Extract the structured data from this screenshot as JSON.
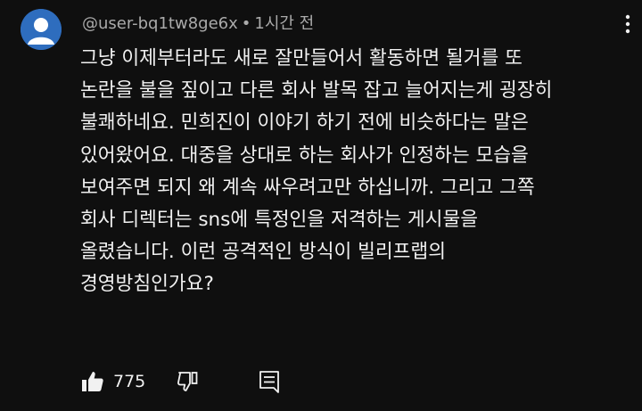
{
  "comment": {
    "author": "@user-bq1tw8ge6x",
    "separator": "•",
    "time": "1시간 전",
    "lines": [
      "그냥 이제부터라도 새로 잘만들어서 활동하면 될거를 또",
      "논란을 불을 짚이고 다른 회사 발목 잡고 늘어지는게 굉장히",
      "불쾌하네요. 민희진이 이야기 하기 전에 비슷하다는 말은",
      "있어왔어요. 대중을 상대로 하는 회사가 인정하는 모습을",
      "보여주면 되지 왜 계속 싸우려고만 하십니까. 그리고 그쪽",
      "회사 디렉터는 sns에 특정인을 저격하는 게시물을",
      "올렸습니다. 이런 공격적인 방식이 빌리프랩의",
      "경영방침인가요?"
    ],
    "like_count": "775"
  },
  "icons": {
    "avatar": "default-avatar-icon",
    "more": "more-vertical-icon",
    "like": "thumbs-up-icon",
    "dislike": "thumbs-down-icon",
    "reply": "reply-comment-icon"
  },
  "colors": {
    "background": "#0f0f0f",
    "text": "#f1f1f1",
    "secondary_text": "#aaaaaa",
    "avatar_bg": "#2e6dbe"
  }
}
